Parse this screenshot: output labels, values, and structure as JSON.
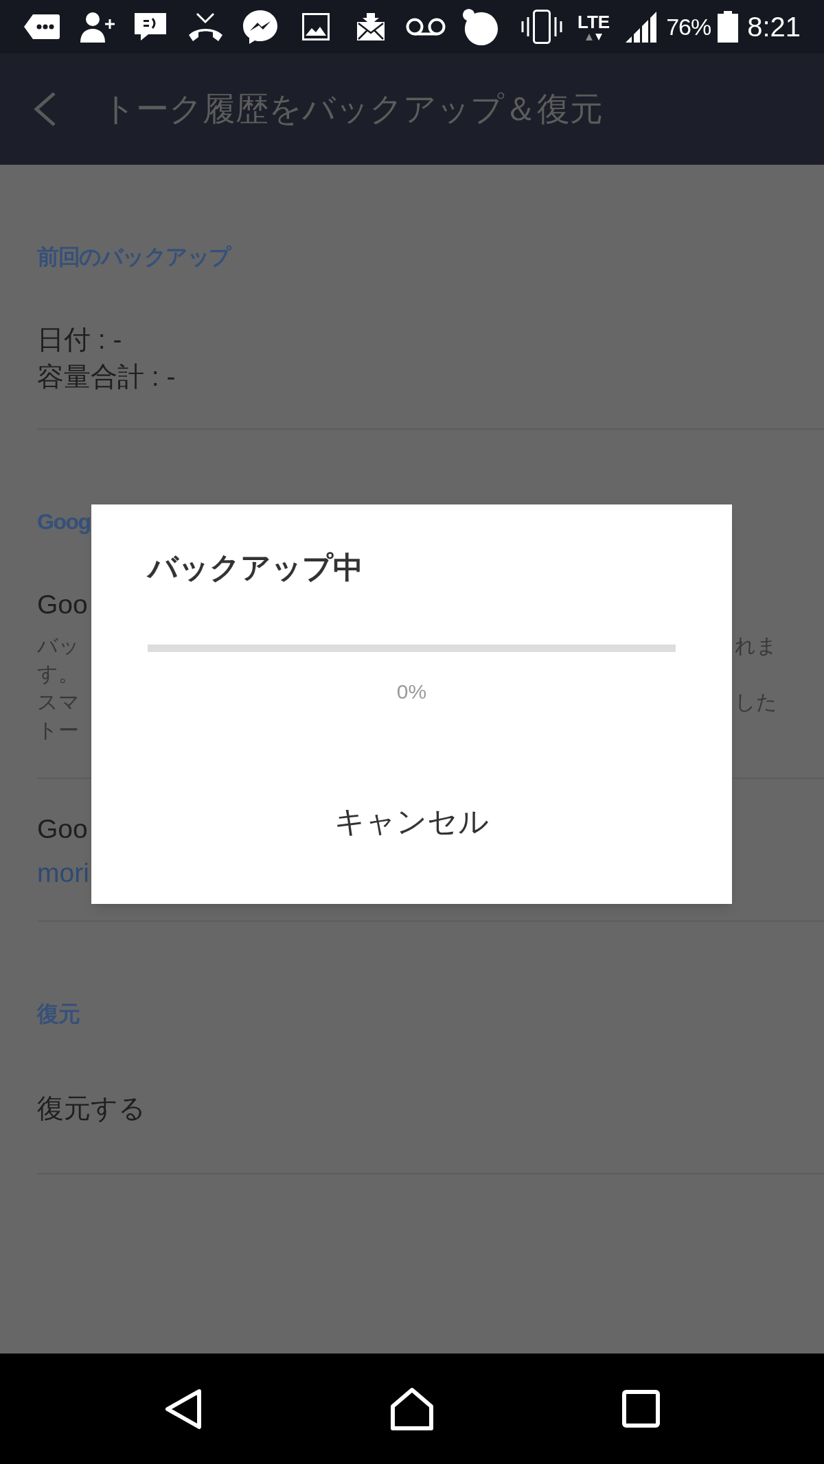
{
  "status_bar": {
    "network": "LTE",
    "battery": "76%",
    "time": "8:21"
  },
  "header": {
    "title": "トーク履歴をバックアップ＆復元"
  },
  "sections": [
    {
      "header": "前回のバックアップ",
      "rows": [
        {
          "kind": "info",
          "lines": [
            "日付 : -",
            "容量合計 : -"
          ]
        }
      ]
    },
    {
      "header": "Goog",
      "rows": [
        {
          "kind": "setting",
          "title": "Goo",
          "description_lines": [
            {
              "left": "バッ",
              "right": "れま"
            },
            {
              "left": "す。"
            },
            {
              "left": "スマ",
              "right": "した"
            },
            {
              "left": "トー"
            }
          ]
        },
        {
          "kind": "account",
          "title": "Goo",
          "value": "mori"
        }
      ]
    },
    {
      "header": "復元",
      "rows": [
        {
          "kind": "action",
          "title": "復元する"
        }
      ]
    }
  ],
  "dialog": {
    "title": "バックアップ中",
    "progress": {
      "level": 0,
      "reading": "0%"
    },
    "button": "キャンセル"
  }
}
